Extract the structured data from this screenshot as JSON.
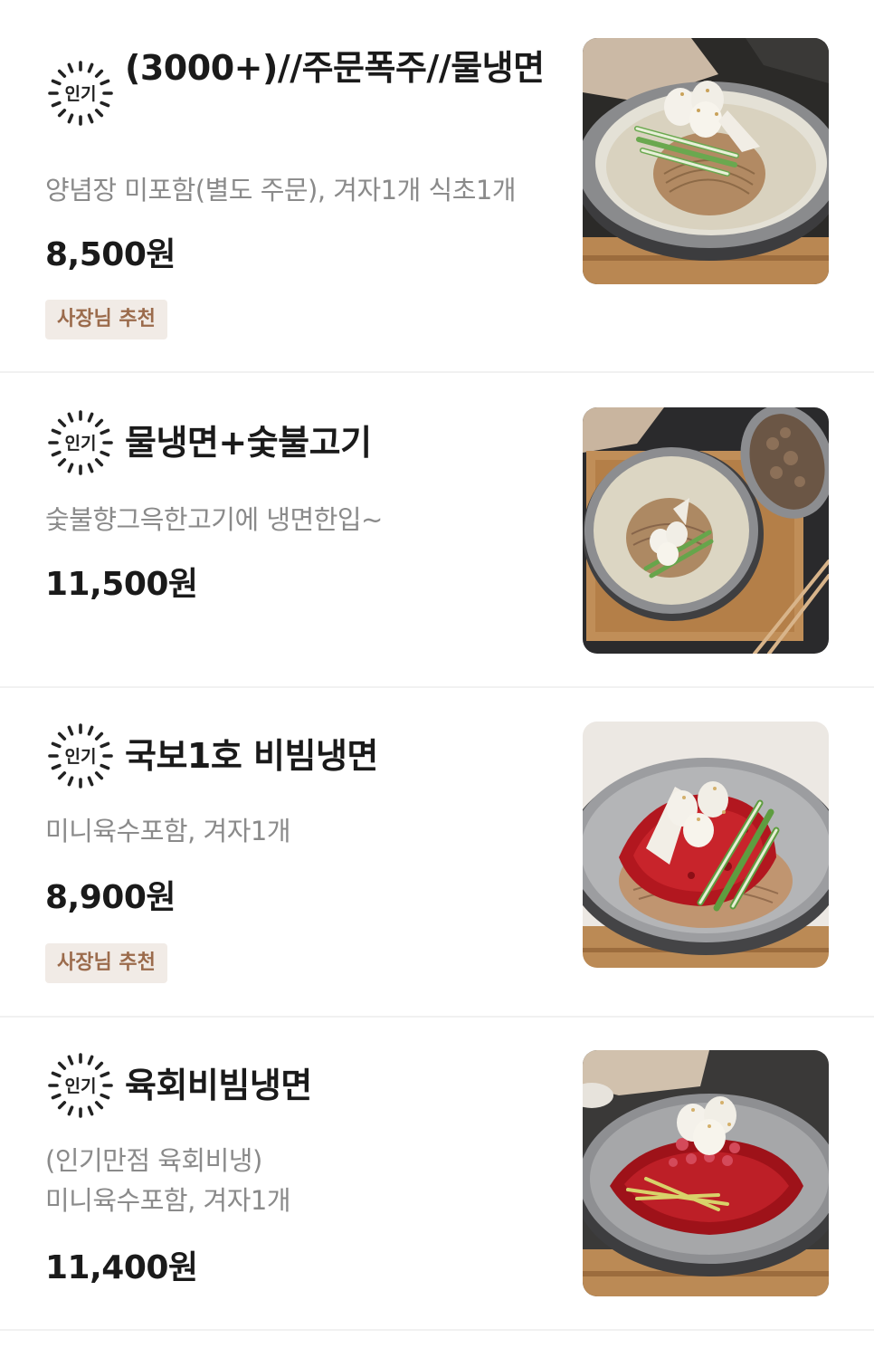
{
  "badge_label": "인기",
  "tag_label": "사장님 추천",
  "items": [
    {
      "title": "(3000+)//주문폭주//물냉면",
      "description": "양념장 미포함(별도 주문), 겨자1개 식초1개",
      "price": "8,500원",
      "has_tag": true,
      "image": "mul-naengmyeon-photo"
    },
    {
      "title": "물냉면+숯불고기",
      "description": "숯불향그윽한고기에 냉면한입~",
      "price": "11,500원",
      "has_tag": false,
      "image": "mul-naengmyeon-bulgogi-photo"
    },
    {
      "title": "국보1호 비빔냉면",
      "description": "미니육수포함, 겨자1개",
      "price": "8,900원",
      "has_tag": true,
      "image": "bibim-naengmyeon-photo"
    },
    {
      "title": "육회비빔냉면",
      "description": "(인기만점 육회비냉)\n미니육수포함, 겨자1개",
      "price": "11,400원",
      "has_tag": false,
      "image": "yukhoe-bibim-naengmyeon-photo"
    }
  ],
  "colors": {
    "tag_bg": "#f1ebe6",
    "tag_text": "#9b6b4c",
    "desc_text": "#8a8a8a",
    "divider": "#f1f1f1"
  }
}
